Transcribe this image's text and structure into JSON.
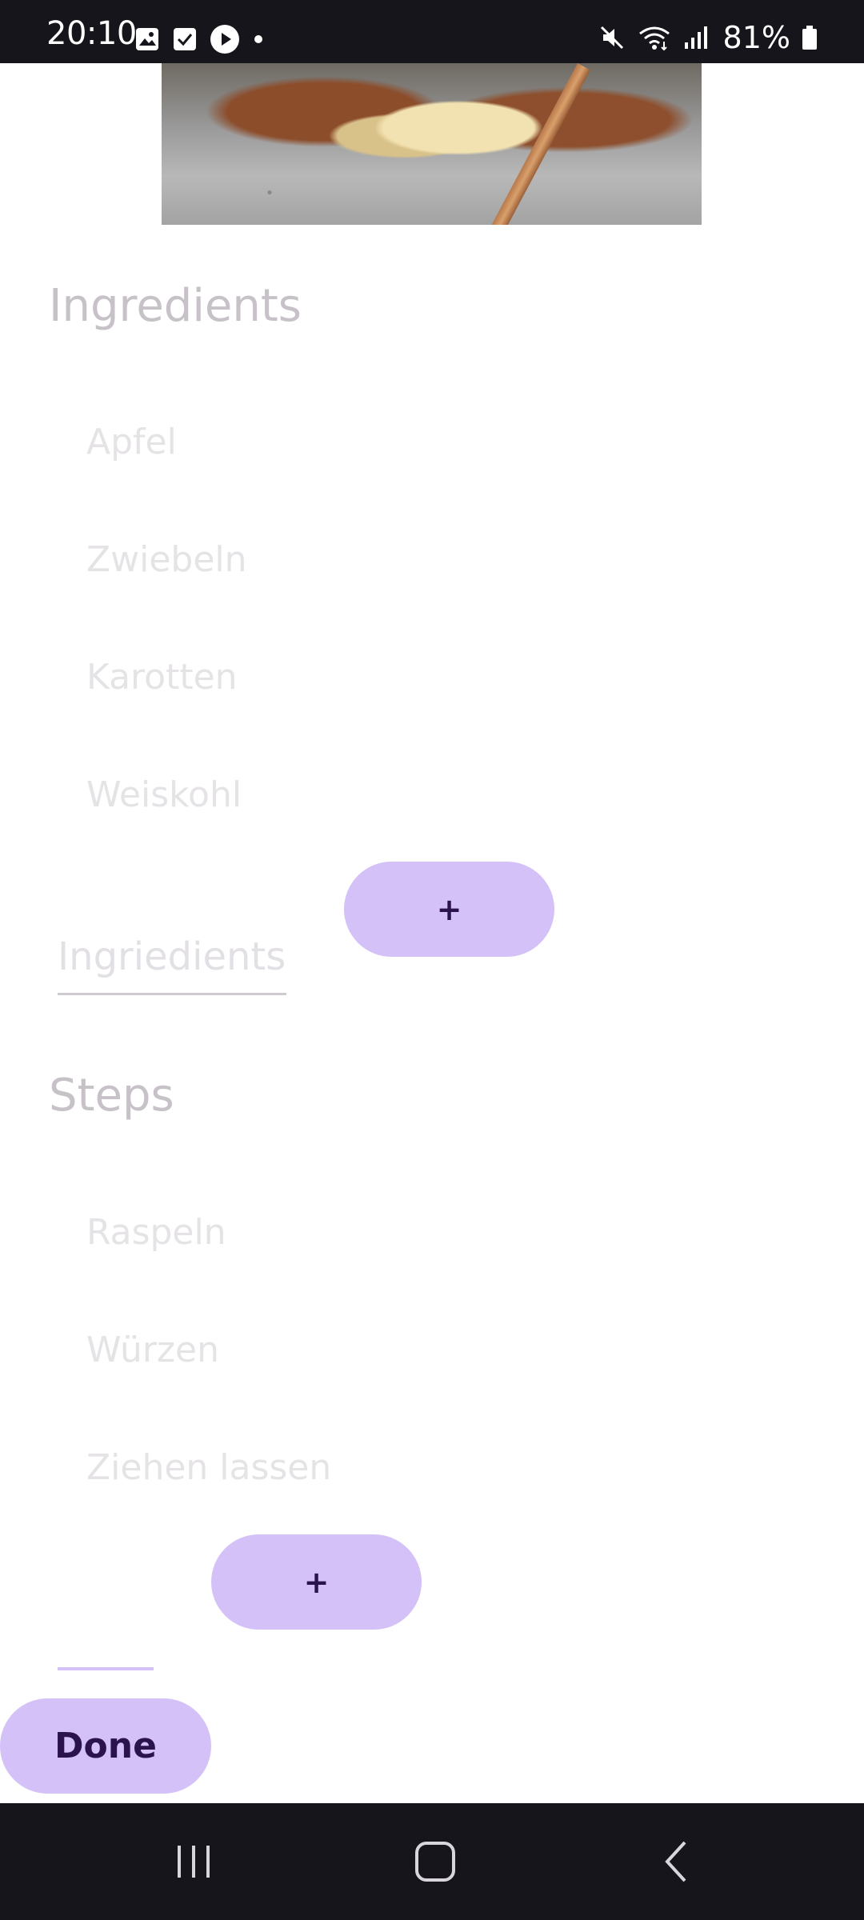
{
  "status_bar": {
    "time": "20:10",
    "left_icons": [
      "image-icon",
      "checkbox-icon",
      "play-icon",
      "dot-icon"
    ],
    "right_icons": [
      "mute-icon",
      "wifi-icon",
      "signal-icon",
      "battery-icon"
    ],
    "battery": "81%"
  },
  "image": {
    "semantic": "recipe-photo"
  },
  "ingredients": {
    "title": "Ingredients",
    "items": [
      "Apfel",
      "Zwiebeln",
      "Karotten",
      "Weiskohl"
    ],
    "add_button_label": "+",
    "input_placeholder": "Ingriedients"
  },
  "steps": {
    "title": "Steps",
    "items": [
      "Raspeln",
      "Würzen",
      "Ziehen lassen"
    ],
    "add_button_label": "+"
  },
  "done_button": {
    "label": "Done"
  },
  "nav_bar": {
    "recents": "recents-icon",
    "home": "home-icon",
    "back": "back-icon"
  },
  "colors": {
    "status_bar_bg": "#16151b",
    "accent_pill": "#d3c1f8",
    "accent_text": "#2b134d",
    "heading_text": "#c7c1c8",
    "item_text": "#e5e3e6"
  }
}
